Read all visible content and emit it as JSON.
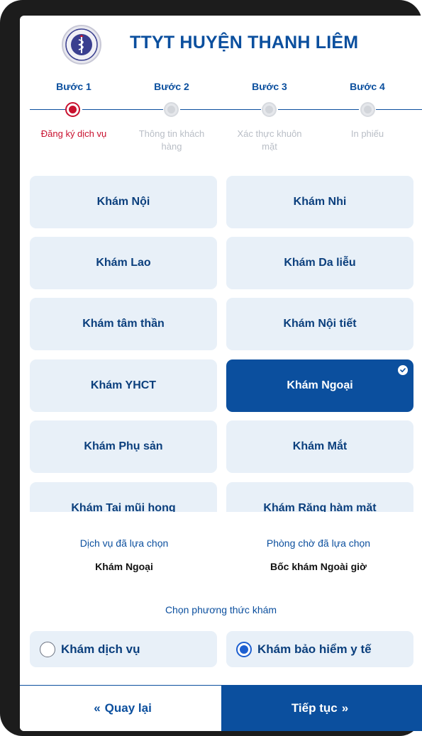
{
  "header": {
    "title": "TTYT HUYỆN THANH LIÊM"
  },
  "steps": [
    {
      "label": "Bước 1",
      "desc": "Đăng ký dịch vụ",
      "active": true
    },
    {
      "label": "Bước 2",
      "desc": "Thông tin khách hàng",
      "active": false
    },
    {
      "label": "Bước 3",
      "desc": "Xác thực khuôn mặt",
      "active": false
    },
    {
      "label": "Bước 4",
      "desc": "In phiếu",
      "active": false
    }
  ],
  "services": [
    {
      "label": "Khám Nội",
      "selected": false
    },
    {
      "label": "Khám Nhi",
      "selected": false
    },
    {
      "label": "Khám Lao",
      "selected": false
    },
    {
      "label": "Khám Da liễu",
      "selected": false
    },
    {
      "label": "Khám tâm thần",
      "selected": false
    },
    {
      "label": "Khám Nội tiết",
      "selected": false
    },
    {
      "label": "Khám YHCT",
      "selected": false
    },
    {
      "label": "Khám Ngoại",
      "selected": true
    },
    {
      "label": "Khám Phụ sản",
      "selected": false
    },
    {
      "label": "Khám Mắt",
      "selected": false
    },
    {
      "label": "Khám Tai mũi họng",
      "selected": false
    },
    {
      "label": "Khám Răng hàm mặt",
      "selected": false
    }
  ],
  "summary": {
    "service_label": "Dịch vụ đã lựa chọn",
    "service_value": "Khám Ngoại",
    "room_label": "Phòng chờ đã lựa chọn",
    "room_value": "Bốc khám Ngoài giờ"
  },
  "method": {
    "label": "Chọn phương thức khám",
    "options": [
      {
        "label": "Khám dịch vụ",
        "selected": false
      },
      {
        "label": "Khám bảo hiểm y tế",
        "selected": true
      }
    ]
  },
  "footer": {
    "back_label": "Quay lại",
    "next_label": "Tiếp tục"
  },
  "colors": {
    "primary": "#0b4f9e",
    "active_step": "#c8102e",
    "tile_bg": "#e8f0f8"
  }
}
